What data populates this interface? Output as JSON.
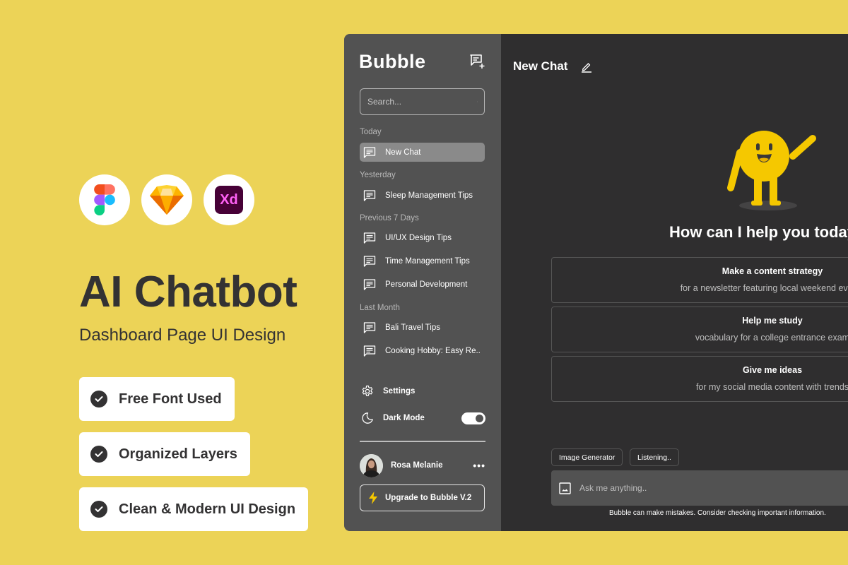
{
  "promo": {
    "tools": [
      {
        "name": "Figma",
        "icon": "figma-logo"
      },
      {
        "name": "Sketch",
        "icon": "sketch-logo"
      },
      {
        "name": "Adobe XD",
        "icon": "xd-logo",
        "label": "Xd"
      }
    ],
    "title": "AI Chatbot",
    "subtitle": "Dashboard Page UI Design",
    "features": [
      {
        "label": "Free Font Used",
        "icon": "check-circle-icon"
      },
      {
        "label": "Organized Layers",
        "icon": "check-circle-icon"
      },
      {
        "label": "Clean & Modern UI Design",
        "icon": "check-circle-icon"
      }
    ],
    "colors": {
      "background": "#ecd357",
      "text": "#333233"
    }
  },
  "app": {
    "logo": "Bubble",
    "search": {
      "placeholder": "Search..."
    },
    "sections": [
      {
        "label": "Today",
        "items": [
          {
            "label": "New Chat",
            "active": true
          }
        ]
      },
      {
        "label": "Yesterday",
        "items": [
          {
            "label": "Sleep Management Tips"
          }
        ]
      },
      {
        "label": "Previous 7 Days",
        "items": [
          {
            "label": "UI/UX Design Tips"
          },
          {
            "label": "Time Management Tips"
          },
          {
            "label": "Personal Development"
          }
        ]
      },
      {
        "label": "Last Month",
        "items": [
          {
            "label": "Bali Travel Tips"
          },
          {
            "label": "Cooking Hobby: Easy Re.."
          }
        ]
      }
    ],
    "settings_label": "Settings",
    "dark_mode": {
      "label": "Dark Mode",
      "enabled": true
    },
    "user": {
      "name": "Rosa Melanie",
      "more_label": "•••"
    },
    "upgrade_label": "Upgrade to Bubble V.2",
    "main": {
      "chat_title": "New Chat",
      "greeting": "How can I help you today?",
      "prompts": [
        {
          "title": "Make a content strategy",
          "subtitle": "for a newsletter featuring local weekend events"
        },
        {
          "title": "Help me study",
          "subtitle": "vocabulary for a college entrance exam"
        },
        {
          "title": "Give me ideas",
          "subtitle": "for my social media content with trends"
        }
      ],
      "chips": [
        "Image Generator",
        "Listening.."
      ],
      "input": {
        "placeholder": "Ask me anything.."
      },
      "disclaimer": "Bubble can make mistakes. Consider checking important information."
    },
    "colors": {
      "sidebar": "#525252",
      "main": "#2f2e2f",
      "accent": "#f5c800",
      "active_item": "#8a8a8a"
    }
  }
}
